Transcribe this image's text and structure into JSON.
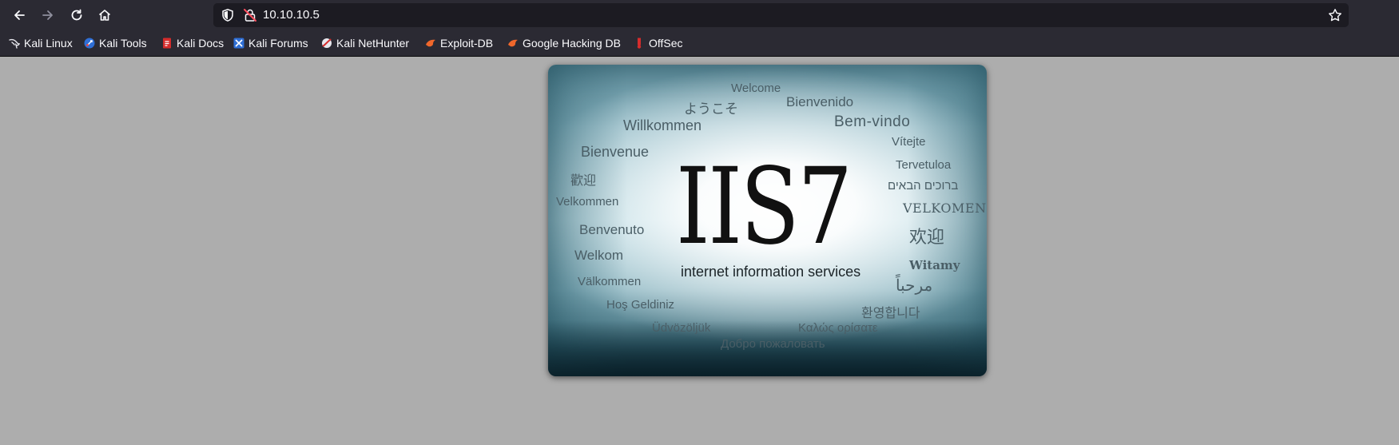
{
  "browser": {
    "nav": {
      "back_icon": "arrow-left-icon",
      "forward_icon": "arrow-right-icon",
      "reload_icon": "reload-icon",
      "home_icon": "home-icon"
    },
    "address_bar": {
      "url": "10.10.10.5",
      "shield_icon": "shield-icon",
      "lock_icon": "insecure-lock-icon",
      "bookmark_icon": "star-icon"
    },
    "bookmarks": [
      {
        "label": "Kali Linux",
        "icon": "kali-dragon-icon"
      },
      {
        "label": "Kali Tools",
        "icon": "kali-tools-icon"
      },
      {
        "label": "Kali Docs",
        "icon": "kali-docs-icon"
      },
      {
        "label": "Kali Forums",
        "icon": "kali-forums-icon"
      },
      {
        "label": "Kali NetHunter",
        "icon": "nethunter-icon"
      },
      {
        "label": "Exploit-DB",
        "icon": "exploit-db-icon"
      },
      {
        "label": "Google Hacking DB",
        "icon": "ghdb-icon"
      },
      {
        "label": "OffSec",
        "icon": "offsec-icon"
      }
    ]
  },
  "page": {
    "background": "#adadad",
    "welcome_image": {
      "logo": "IIS7",
      "subtitle": "internet information services",
      "words": [
        "Welcome",
        "ようこそ",
        "Bienvenido",
        "Willkommen",
        "Bem-vindo",
        "Vítejte",
        "Bienvenue",
        "Tervetuloa",
        "歡迎",
        "ברוכים הבאים",
        "Velkommen",
        "VELKOMEN",
        "Benvenuto",
        "欢迎",
        "Welkom",
        "Witamy",
        "Välkommen",
        "مرحباً",
        "Hoş Geldiniz",
        "환영합니다",
        "Üdvözöljük",
        "Καλώς ορίσατε",
        "Добро пожаловать"
      ]
    }
  }
}
